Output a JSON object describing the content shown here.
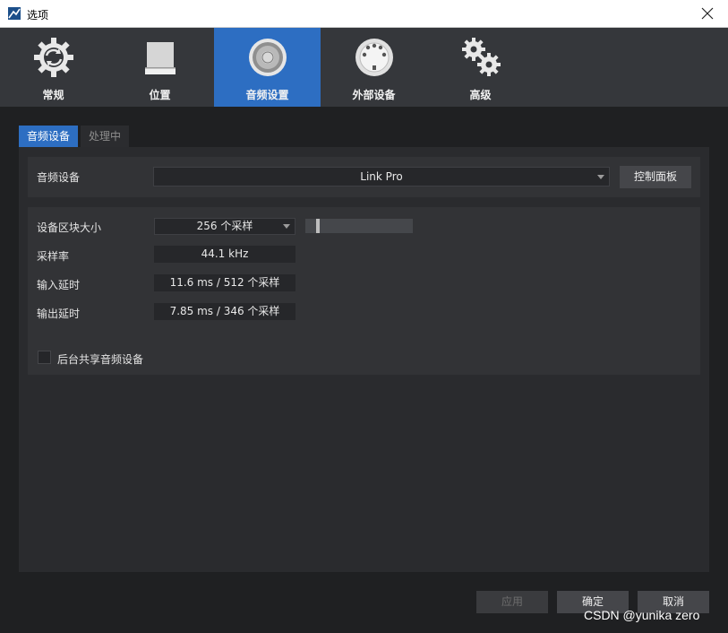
{
  "window": {
    "title": "选项"
  },
  "categories": [
    {
      "label": "常规",
      "icon": "sync-gear-icon"
    },
    {
      "label": "位置",
      "icon": "hard-drive-icon"
    },
    {
      "label": "音频设置",
      "icon": "speaker-icon",
      "active": true
    },
    {
      "label": "外部设备",
      "icon": "midi-port-icon"
    },
    {
      "label": "高级",
      "icon": "gears-icon"
    }
  ],
  "subtabs": {
    "audio_device": "音频设备",
    "processing": "处理中"
  },
  "device": {
    "label": "音频设备",
    "value": "Link Pro",
    "control_panel": "控制面板"
  },
  "settings": {
    "block_size_label": "设备区块大小",
    "block_size_value": "256 个采样",
    "block_slider_level": 0.1,
    "sample_rate_label": "采样率",
    "sample_rate_value": "44.1 kHz",
    "input_latency_label": "输入延时",
    "input_latency_value": "11.6 ms / 512 个采样",
    "output_latency_label": "输出延时",
    "output_latency_value": "7.85 ms / 346 个采样",
    "share_label": "后台共享音频设备",
    "share_checked": false
  },
  "footer": {
    "apply": "应用",
    "ok": "确定",
    "cancel": "取消"
  },
  "watermark": "CSDN @yunika zero",
  "colors": {
    "accent": "#2d6ec2",
    "background": "#1f2022",
    "panel": "#2a2b2e"
  }
}
